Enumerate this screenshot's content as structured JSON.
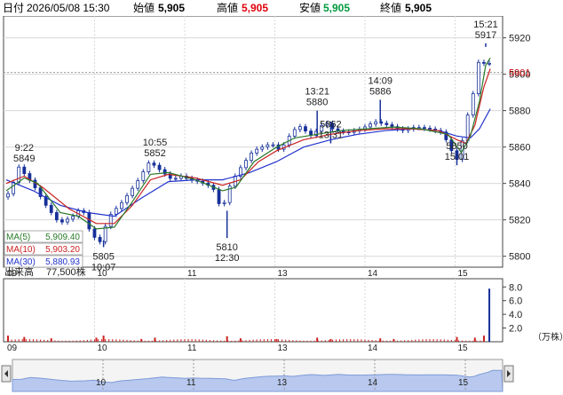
{
  "header": {
    "date_label": "日付",
    "date_value": "2026/05/08 15:30",
    "open_label": "始値",
    "open_value": "5,905",
    "high_label": "高値",
    "high_value": "5,905",
    "low_label": "安値",
    "low_value": "5,905",
    "close_label": "終値",
    "close_value": "5,905"
  },
  "colors": {
    "up": "#cc0000",
    "high": "#e0000a",
    "low": "#009a3e",
    "ma5": "#2a7a2a",
    "ma10": "#cc2222",
    "ma30": "#2233cc",
    "candle": "#16309a",
    "price_marker": "#cc0000",
    "nav_fill": "#b8c8ee"
  },
  "chart_data": {
    "type": "candlestick",
    "y_axis": {
      "ticks": [
        "5920",
        "5900",
        "5880",
        "5860",
        "5840",
        "5820",
        "5800"
      ],
      "range": [
        5794,
        5932
      ]
    },
    "x_axis": {
      "labels": [
        "09",
        "10",
        "11",
        "13",
        "14",
        "15"
      ]
    },
    "current_price": "5901",
    "close_path": [
      [
        0,
        5832
      ],
      [
        0.1,
        5835
      ],
      [
        0.2,
        5849
      ],
      [
        0.35,
        5840
      ],
      [
        0.5,
        5828
      ],
      [
        0.65,
        5818
      ],
      [
        0.8,
        5822
      ],
      [
        0.9,
        5827
      ],
      [
        1.0,
        5812
      ],
      [
        1.1,
        5808
      ],
      [
        1.2,
        5822
      ],
      [
        1.35,
        5830
      ],
      [
        1.5,
        5840
      ],
      [
        1.65,
        5852
      ],
      [
        1.8,
        5846
      ],
      [
        1.9,
        5842
      ],
      [
        2.0,
        5844
      ],
      [
        2.1,
        5842
      ],
      [
        2.2,
        5841
      ],
      [
        2.35,
        5838
      ],
      [
        2.45,
        5825
      ],
      [
        2.55,
        5840
      ],
      [
        2.65,
        5848
      ],
      [
        2.8,
        5858
      ],
      [
        3.0,
        5862
      ],
      [
        3.1,
        5858
      ],
      [
        3.2,
        5866
      ],
      [
        3.3,
        5872
      ],
      [
        3.45,
        5866
      ],
      [
        3.6,
        5874
      ],
      [
        3.7,
        5869
      ],
      [
        3.85,
        5868
      ],
      [
        4.0,
        5870
      ],
      [
        4.15,
        5874
      ],
      [
        4.3,
        5872
      ],
      [
        4.45,
        5869
      ],
      [
        4.6,
        5871
      ],
      [
        4.75,
        5870
      ],
      [
        4.9,
        5868
      ],
      [
        5.0,
        5858
      ],
      [
        5.05,
        5852
      ],
      [
        5.1,
        5858
      ],
      [
        5.15,
        5872
      ],
      [
        5.22,
        5885
      ],
      [
        5.28,
        5898
      ],
      [
        5.32,
        5915
      ],
      [
        5.35,
        5906
      ]
    ],
    "ma5": [
      [
        0,
        5836
      ],
      [
        0.2,
        5843
      ],
      [
        0.35,
        5840
      ],
      [
        0.6,
        5824
      ],
      [
        0.8,
        5822
      ],
      [
        1.0,
        5815
      ],
      [
        1.2,
        5816
      ],
      [
        1.4,
        5830
      ],
      [
        1.6,
        5845
      ],
      [
        1.8,
        5846
      ],
      [
        2.1,
        5842
      ],
      [
        2.4,
        5836
      ],
      [
        2.55,
        5838
      ],
      [
        2.75,
        5852
      ],
      [
        3.0,
        5860
      ],
      [
        3.2,
        5865
      ],
      [
        3.45,
        5867
      ],
      [
        3.7,
        5869
      ],
      [
        4.0,
        5870
      ],
      [
        4.3,
        5871
      ],
      [
        4.6,
        5870
      ],
      [
        4.9,
        5867
      ],
      [
        5.05,
        5857
      ],
      [
        5.15,
        5866
      ],
      [
        5.25,
        5885
      ],
      [
        5.32,
        5905
      ],
      [
        5.37,
        5909
      ]
    ],
    "ma10": [
      [
        0,
        5840
      ],
      [
        0.2,
        5844
      ],
      [
        0.4,
        5838
      ],
      [
        0.7,
        5826
      ],
      [
        1.0,
        5818
      ],
      [
        1.2,
        5818
      ],
      [
        1.4,
        5828
      ],
      [
        1.6,
        5842
      ],
      [
        1.8,
        5845
      ],
      [
        2.1,
        5843
      ],
      [
        2.4,
        5839
      ],
      [
        2.6,
        5842
      ],
      [
        2.8,
        5852
      ],
      [
        3.0,
        5858
      ],
      [
        3.3,
        5864
      ],
      [
        3.6,
        5867
      ],
      [
        3.9,
        5869
      ],
      [
        4.2,
        5870
      ],
      [
        4.5,
        5870
      ],
      [
        4.8,
        5869
      ],
      [
        5.0,
        5864
      ],
      [
        5.1,
        5862
      ],
      [
        5.2,
        5872
      ],
      [
        5.3,
        5893
      ],
      [
        5.37,
        5903
      ]
    ],
    "ma30": [
      [
        0,
        5842
      ],
      [
        0.3,
        5836
      ],
      [
        0.6,
        5828
      ],
      [
        0.9,
        5824
      ],
      [
        1.2,
        5822
      ],
      [
        1.5,
        5832
      ],
      [
        1.8,
        5841
      ],
      [
        2.1,
        5842
      ],
      [
        2.4,
        5842
      ],
      [
        2.7,
        5846
      ],
      [
        3.0,
        5852
      ],
      [
        3.3,
        5860
      ],
      [
        3.6,
        5864
      ],
      [
        3.9,
        5867
      ],
      [
        4.2,
        5869
      ],
      [
        4.5,
        5870
      ],
      [
        4.8,
        5869
      ],
      [
        5.0,
        5866
      ],
      [
        5.15,
        5865
      ],
      [
        5.25,
        5870
      ],
      [
        5.37,
        5881
      ]
    ],
    "annotations": [
      {
        "x": 0.2,
        "price": 5849,
        "dir": "up",
        "time": "9:22",
        "value": "5849"
      },
      {
        "x": 1.08,
        "price": 5805,
        "dir": "down",
        "time": "10:07",
        "value": "5805"
      },
      {
        "x": 1.65,
        "price": 5852,
        "dir": "up",
        "time": "10:55",
        "value": "5852"
      },
      {
        "x": 2.45,
        "price": 5810,
        "dir": "down",
        "time": "12:30",
        "value": "5810"
      },
      {
        "x": 3.45,
        "price": 5880,
        "dir": "up",
        "time": "13:21",
        "value": "5880"
      },
      {
        "x": 3.6,
        "price": 5862,
        "dir": "down",
        "time": "13:31",
        "value": "5862",
        "order": "value-first"
      },
      {
        "x": 4.15,
        "price": 5886,
        "dir": "up",
        "time": "14:09",
        "value": "5886"
      },
      {
        "x": 5.0,
        "price": 5850,
        "dir": "down",
        "time": "15:01",
        "value": "5850",
        "order": "value-first"
      },
      {
        "x": 5.32,
        "price": 5917,
        "dir": "up",
        "time": "15:21",
        "value": "5917"
      }
    ],
    "legend": [
      {
        "name": "MA(5)",
        "value": "5,909.40",
        "color_key": "ma5"
      },
      {
        "name": "MA(10)",
        "value": "5,903.20",
        "color_key": "ma10"
      },
      {
        "name": "MA(30)",
        "value": "5,880.93",
        "color_key": "ma30"
      }
    ],
    "volume": {
      "label": "出来高",
      "value": "77,500株",
      "unit": "（万株）",
      "ticks": [
        "8.0",
        "6.0",
        "4.0",
        "2.0"
      ],
      "range": [
        0,
        9.2
      ],
      "bars": [
        [
          0.02,
          0.9
        ],
        [
          0.2,
          0.7
        ],
        [
          0.5,
          0.5
        ],
        [
          1.0,
          0.6
        ],
        [
          1.08,
          0.9
        ],
        [
          1.5,
          0.4
        ],
        [
          1.65,
          0.6
        ],
        [
          2.45,
          0.8
        ],
        [
          2.6,
          0.5
        ],
        [
          3.0,
          0.4
        ],
        [
          3.45,
          0.6
        ],
        [
          3.6,
          0.4
        ],
        [
          4.15,
          0.5
        ],
        [
          4.3,
          0.4
        ],
        [
          5.0,
          0.7
        ],
        [
          5.2,
          0.6
        ],
        [
          5.3,
          0.9
        ],
        [
          5.36,
          7.75
        ]
      ]
    },
    "navigator": {
      "labels": [
        "10",
        "11",
        "13",
        "14",
        "15"
      ]
    }
  }
}
